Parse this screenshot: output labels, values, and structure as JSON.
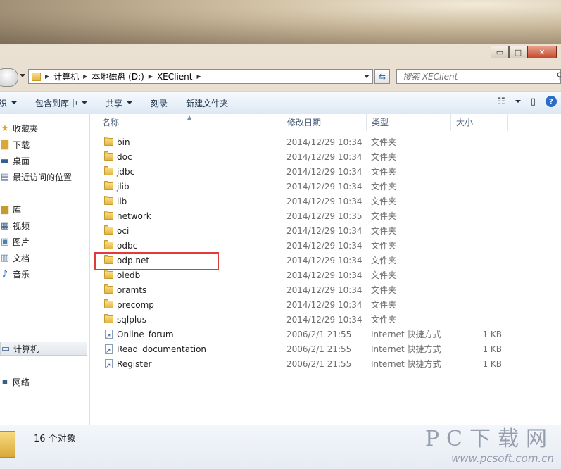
{
  "window": {
    "minimize_glyph": "▭",
    "maximize_glyph": "□",
    "close_glyph": "✕"
  },
  "address": {
    "crumbs": [
      "计算机",
      "本地磁盘 (D:)",
      "XEClient"
    ],
    "search_placeholder": "搜索 XEClient"
  },
  "toolbar": {
    "organize": "织",
    "include_library": "包含到库中",
    "share": "共享",
    "burn": "刻录",
    "new_folder": "新建文件夹",
    "help": "?"
  },
  "nav": {
    "favorites": "收藏夹",
    "downloads": "下载",
    "desktop": "桌面",
    "recent": "最近访问的位置",
    "libraries": "库",
    "videos": "视频",
    "pictures": "图片",
    "documents": "文档",
    "music": "音乐",
    "computer": "计算机",
    "network": "网络"
  },
  "columns": {
    "name": "名称",
    "modified": "修改日期",
    "type": "类型",
    "size": "大小"
  },
  "files": [
    {
      "name": "bin",
      "date": "2014/12/29 10:34",
      "type": "文件夹",
      "size": ""
    },
    {
      "name": "doc",
      "date": "2014/12/29 10:34",
      "type": "文件夹",
      "size": ""
    },
    {
      "name": "jdbc",
      "date": "2014/12/29 10:34",
      "type": "文件夹",
      "size": ""
    },
    {
      "name": "jlib",
      "date": "2014/12/29 10:34",
      "type": "文件夹",
      "size": ""
    },
    {
      "name": "lib",
      "date": "2014/12/29 10:34",
      "type": "文件夹",
      "size": ""
    },
    {
      "name": "network",
      "date": "2014/12/29 10:35",
      "type": "文件夹",
      "size": ""
    },
    {
      "name": "oci",
      "date": "2014/12/29 10:34",
      "type": "文件夹",
      "size": ""
    },
    {
      "name": "odbc",
      "date": "2014/12/29 10:34",
      "type": "文件夹",
      "size": ""
    },
    {
      "name": "odp.net",
      "date": "2014/12/29 10:34",
      "type": "文件夹",
      "size": ""
    },
    {
      "name": "oledb",
      "date": "2014/12/29 10:34",
      "type": "文件夹",
      "size": ""
    },
    {
      "name": "oramts",
      "date": "2014/12/29 10:34",
      "type": "文件夹",
      "size": ""
    },
    {
      "name": "precomp",
      "date": "2014/12/29 10:34",
      "type": "文件夹",
      "size": ""
    },
    {
      "name": "sqlplus",
      "date": "2014/12/29 10:34",
      "type": "文件夹",
      "size": ""
    },
    {
      "name": "Online_forum",
      "date": "2006/2/1 21:55",
      "type": "Internet 快捷方式",
      "size": "1 KB"
    },
    {
      "name": "Read_documentation",
      "date": "2006/2/1 21:55",
      "type": "Internet 快捷方式",
      "size": "1 KB"
    },
    {
      "name": "Register",
      "date": "2006/2/1 21:55",
      "type": "Internet 快捷方式",
      "size": "1 KB"
    }
  ],
  "status": {
    "count": "16 个对象"
  },
  "watermark": {
    "main": "PC下载网",
    "url": "www.pcsoft.com.cn"
  },
  "colors": {
    "highlight": "#e03a3a",
    "folder": "#e3b545",
    "toolbar_text": "#1e3249"
  }
}
